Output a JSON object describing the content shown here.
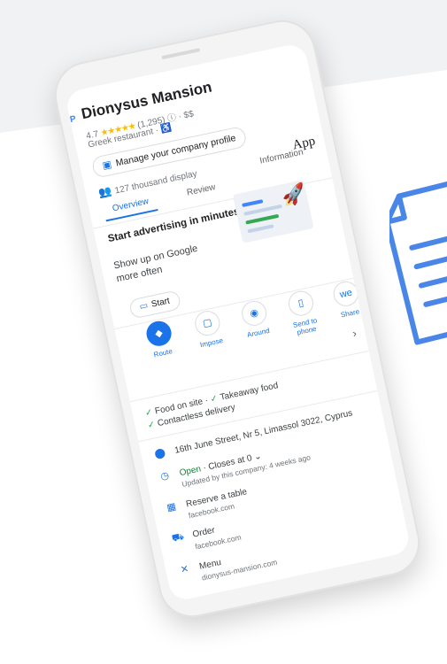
{
  "business": {
    "name": "Dionysus Mansion",
    "rating": "4.7",
    "stars": "★★★★★",
    "review_count": "(1,295)",
    "price": "· $$",
    "category": "Greek restaurant ·"
  },
  "manage_button": "Manage your company profile",
  "views": "127 thousand display",
  "tabs": {
    "overview": "Overview",
    "review": "Review",
    "information": "Information"
  },
  "app_text": "App",
  "promo": {
    "title": "Start advertising in minutes",
    "body": "Show up on Google more often",
    "start": "Start"
  },
  "actions": [
    {
      "label": "Route",
      "icon": "route-icon"
    },
    {
      "label": "Impose",
      "icon": "impose-icon"
    },
    {
      "label": "Around",
      "icon": "around-icon"
    },
    {
      "label": "Send to phone",
      "icon": "send-to-phone-icon"
    },
    {
      "label": "Share",
      "icon": "share-icon"
    }
  ],
  "services": {
    "line1a": "Food on site ·",
    "line1b": "Takeaway food",
    "line2": "Contactless delivery"
  },
  "details": {
    "address": "16th June Street, Nr 5, Limassol 3022, Cyprus",
    "hours_open": "Open",
    "hours_rest": "· Closes at 0",
    "hours_note": "Updated by this company: 4 weeks ago",
    "reserve": "Reserve a table",
    "reserve_src": "facebook.com",
    "order": "Order",
    "order_src": "facebook.com",
    "menu": "Menu",
    "menu_src": "dionysus-mansion.com"
  },
  "colors": {
    "accent": "#1a73e8",
    "stars": "#fbbc04",
    "check": "#34a853",
    "open": "#188038",
    "doc_icon": "#4a86e8"
  }
}
